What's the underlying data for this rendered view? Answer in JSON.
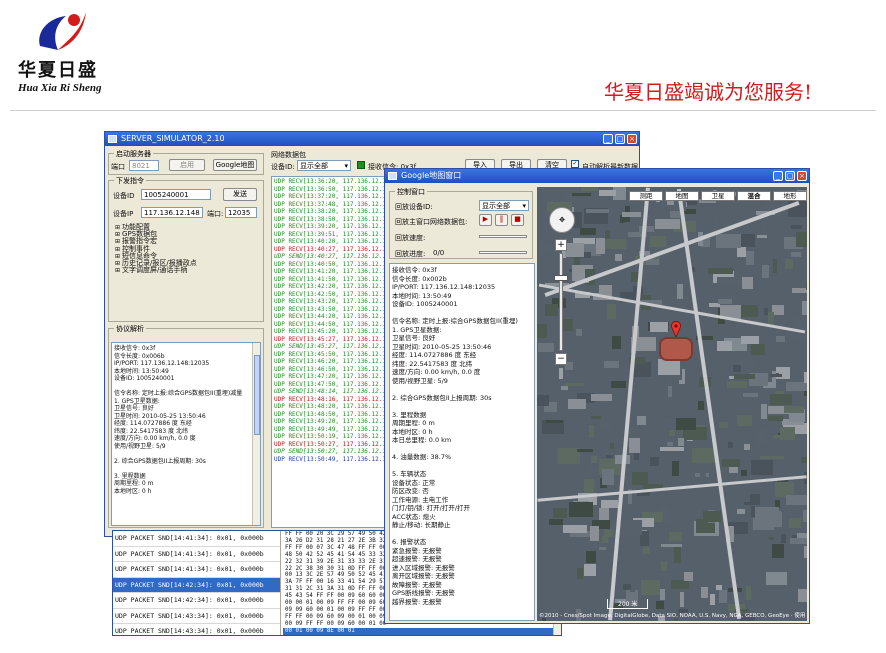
{
  "header": {
    "brand_cn": "华夏日盛",
    "brand_en": "Hua Xia Ri Sheng",
    "slogan": "华夏日盛竭诚为您服务!"
  },
  "colors": {
    "brand_red": "#d21c1c",
    "xp_title": "#1f4fbf",
    "link_green": "#1e8f1e"
  },
  "simulator": {
    "title": "SERVER_SIMULATOR_2.10",
    "start_server": {
      "group_label": "启动服务器",
      "port_label": "端口",
      "port_value": "8021",
      "enable_button": "启用",
      "google_button": "Google地图"
    },
    "send_command": {
      "group_label": "下发指令",
      "device_id_label": "设备ID",
      "device_id_value": "1005240001",
      "send_button": "发送",
      "device_ip_label": "设备IP",
      "device_ip_value": "117.136.12.148",
      "port_label": "端口:",
      "port_value": "12035",
      "tree": [
        "功能配置",
        "GPS数据包",
        "报警指令宏",
        "控制事件",
        "短信息命令",
        "历史记录/报区/报播政点",
        "文字调度屏/通话手柄"
      ]
    },
    "protocol": {
      "group_label": "协议解析",
      "lines": [
        "接收信令: 0x3f",
        "信令长度: 0x006b",
        "IP/PORT: 117.136.12.148:12035",
        "本地时间: 13:50:49",
        "设备ID: 1005240001",
        "",
        "信令名称: 定时上报:综合GPS数据包II(重埋)减量",
        "1. GPS卫星数据:",
        "卫星信号: 良好",
        "卫星时间: 2010-05-25 13:50:46",
        "经度: 114.0727886 度 东经",
        "纬度: 22.5417583 度 北纬",
        "速度/方向: 0.00 km/h, 0.0 度",
        "使用/视野卫星: 5/9",
        "",
        "2. 综合GPS数据包II上报周期: 30s",
        "",
        "3. 里程数据",
        "周期里程: 0 m",
        "本地时区: 0 h"
      ]
    },
    "network": {
      "group_label": "网络数据包",
      "device_label": "设备ID:",
      "device_select": "显示全部",
      "recv_label": "接收信令: 0x3f",
      "import_button": "导入",
      "export_button": "导出",
      "clear_button": "清空",
      "auto_parse_label": "自动解析最新数据",
      "log": [
        {
          "t": "UDP RECV[13:36:20, 117.136.12.148:12",
          "c": "green"
        },
        {
          "t": "UDP RECV[13:36:50, 117.136.12.148:12",
          "c": "green"
        },
        {
          "t": "UDP RECV[13:37:20, 117.136.12.148:12",
          "c": "green"
        },
        {
          "t": "UDP RECV[13:37:48, 117.136.12.148:12",
          "c": "green"
        },
        {
          "t": "UDP RECV[13:38:20, 117.136.12.148:12",
          "c": "green"
        },
        {
          "t": "UDP RECV[13:38:50, 117.136.12.148:12",
          "c": "green"
        },
        {
          "t": "UDP RECV[13:39:20, 117.136.12.148:12",
          "c": "green"
        },
        {
          "t": "UDP RECV[13:39:51, 117.136.12.148:12",
          "c": "green"
        },
        {
          "t": "UDP RECV[13:40:20, 117.136.12.148:12",
          "c": "green"
        },
        {
          "t": "UDP RECV[13:40:27, 117.136.12.148:12",
          "c": "red"
        },
        {
          "t": "UDP SEND[13:40:27, 117.136.12.148:1",
          "c": "green italic"
        },
        {
          "t": "UDP RECV[13:40:50, 117.136.12.148:12",
          "c": "green"
        },
        {
          "t": "UDP RECV[13:41:20, 117.136.12.148:12",
          "c": "green"
        },
        {
          "t": "UDP RECV[13:41:50, 117.136.12.148:12",
          "c": "green"
        },
        {
          "t": "UDP RECV[13:42:20, 117.136.12.148:12",
          "c": "green"
        },
        {
          "t": "UDP RECV[13:42:50, 117.136.12.148:12",
          "c": "green"
        },
        {
          "t": "UDP RECV[13:43:20, 117.136.12.148:12",
          "c": "green"
        },
        {
          "t": "UDP RECV[13:43:50, 117.136.12.148:12",
          "c": "green"
        },
        {
          "t": "UDP RECV[13:44:20, 117.136.12.148:12",
          "c": "green"
        },
        {
          "t": "UDP RECV[13:44:50, 117.136.12.148:12",
          "c": "green"
        },
        {
          "t": "UDP RECV[13:45:20, 117.136.12.148:12",
          "c": "green"
        },
        {
          "t": "UDP RECV[13:45:27, 117.136.12.148:12",
          "c": "red"
        },
        {
          "t": "UDP SEND[13:45:27, 117.136.12.148:1",
          "c": "green italic"
        },
        {
          "t": "UDP RECV[13:45:50, 117.136.12.148:12",
          "c": "green"
        },
        {
          "t": "UDP RECV[13:46:20, 117.136.12.148:12",
          "c": "green"
        },
        {
          "t": "UDP RECV[13:46:50, 117.136.12.148:12",
          "c": "green"
        },
        {
          "t": "UDP RECV[13:47:20, 117.136.12.148:12",
          "c": "green"
        },
        {
          "t": "UDP RECV[13:47:50, 117.136.12.148:12",
          "c": "green"
        },
        {
          "t": "UDP SEND[13:48:14, 117.136.12.148:1",
          "c": "green italic"
        },
        {
          "t": "UDP RECV[13:48:16, 117.136.12.148:12",
          "c": "red"
        },
        {
          "t": "UDP RECV[13:48:20, 117.136.12.148:12",
          "c": "green"
        },
        {
          "t": "UDP RECV[13:48:50, 117.136.12.148:12",
          "c": "green"
        },
        {
          "t": "UDP RECV[13:49:20, 117.136.12.148:12",
          "c": "green"
        },
        {
          "t": "UDP RECV[13:49:49, 117.136.12.148:12",
          "c": "green"
        },
        {
          "t": "UDP RECV[13:50:19, 117.136.12.148:12",
          "c": "green"
        },
        {
          "t": "UDP RECV[13:50:27, 117.136.12.148:12",
          "c": "red"
        },
        {
          "t": "UDP SEND[13:50:27, 117.136.12.148:1",
          "c": "green italic"
        },
        {
          "t": "UDP RECV[13:50:49, 117.136.12.148:12",
          "c": "blue"
        }
      ]
    },
    "bottom_log": [
      "UDP PACKET SND[14:41:34]: 0x01, 0x000b",
      "UDP PACKET SND[14:41:34]: 0x01, 0x000b",
      "UDP PACKET SND[14:41:34]: 0x01, 0x000b",
      "UDP PACKET SND[14:42:34]: 0x01, 0x000b",
      "UDP PACKET SND[14:42:34]: 0x01, 0x000b",
      "UDP PACKET SND[14:43:34]: 0x01, 0x000b",
      "UDP PACKET SND[14:43:34]: 0x01, 0x000b"
    ],
    "hex_dump": [
      "FF FF 00 20 3C 29 57 49 50 42",
      "3A 26 D2 31 28 21 27 2E 3B 32",
      "FF FF 00 07 3C 47 48 FF FF 00",
      "48 50 42 52 45 41 54 45 33 32",
      "22 32 31 39 2E 31 33 33 2E 31",
      "22 2C 38 30 30 31 0D FF FF 00",
      "00 13 3C 2E 57 49 50 52 45 41",
      "3A 7F FF 00 16 33 41 54 29 57",
      "31 31 2C 31 3A 31 0D FF FF 00",
      "45 43 54 FF FF 00 09 60 60 00",
      "00 00 01 00 09 FF FF 00 09 60",
      "09 09 60 00 01 00 09 FF FF 00",
      "FF FF 00 09 60 09 00 01 00 09",
      "00 09 FF FF 00 09 60 00 01 00",
      "00 01 00 09 8E 00 01"
    ]
  },
  "google": {
    "title": "Google地图窗口",
    "control": {
      "group_label": "控制窗口",
      "replay_id_label": "回放设备ID:",
      "replay_id_select": "显示全部",
      "replay_route_label": "回放主窗口网络数据包:",
      "play_icon": "▶",
      "pause_icon": "‖",
      "stop_icon": "■",
      "speed_label": "回放速度:",
      "progress_label": "回放进度:",
      "progress_value": "0/0"
    },
    "details": [
      "接收信令: 0x3f",
      "信令长度: 0x002b",
      "IP/PORT: 117.136.12.148:12035",
      "本地时间: 13:50:49",
      "设备ID: 1005240001",
      "",
      "信令名称: 定时上报:综合GPS数据包II(重埋)",
      "1. GPS卫星数据:",
      "卫星信号: 良好",
      "卫星时间: 2010-05-25 13:50:46",
      "经度: 114.0727886 度 东经",
      "纬度: 22.5417583 度 北纬",
      "速度/方向: 0.00 km/h, 0.0 度",
      "使用/视野卫星: 5/9",
      "",
      "2. 综合GPS数据包II上报周期: 30s",
      "",
      "3. 里程数据",
      "周期里程: 0 m",
      "本地时区: 0 h",
      "本日总里程: 0.0 km",
      "",
      "4. 油量数据: 38.7%",
      "",
      "5. 车辆状态",
      "设备状态: 正常",
      "防区改变: 否",
      "工作电源: 主电工作",
      "门灯/钥/锁: 打开/打开/打开",
      "ACC状态: 熄火",
      "静止/移动: 长期静止",
      "",
      "6. 报警状态",
      "紧急报警: 无报警",
      "超速报警: 无报警",
      "进入区域报警: 无报警",
      "离开区域报警: 无报警",
      "故障报警: 无报警",
      "GPS断线报警: 无报警",
      "越界报警: 无报警"
    ],
    "map": {
      "type_tabs": [
        "测距",
        "地图",
        "卫星",
        "混合",
        "地形"
      ],
      "scale": "200 米",
      "attribution": "©2010 - Cnes/Spot Image, DigitalGlobe, Data SIO, NOAA, U.S. Navy, NGA, GEBCO, GeoEye · 使用条款"
    }
  }
}
